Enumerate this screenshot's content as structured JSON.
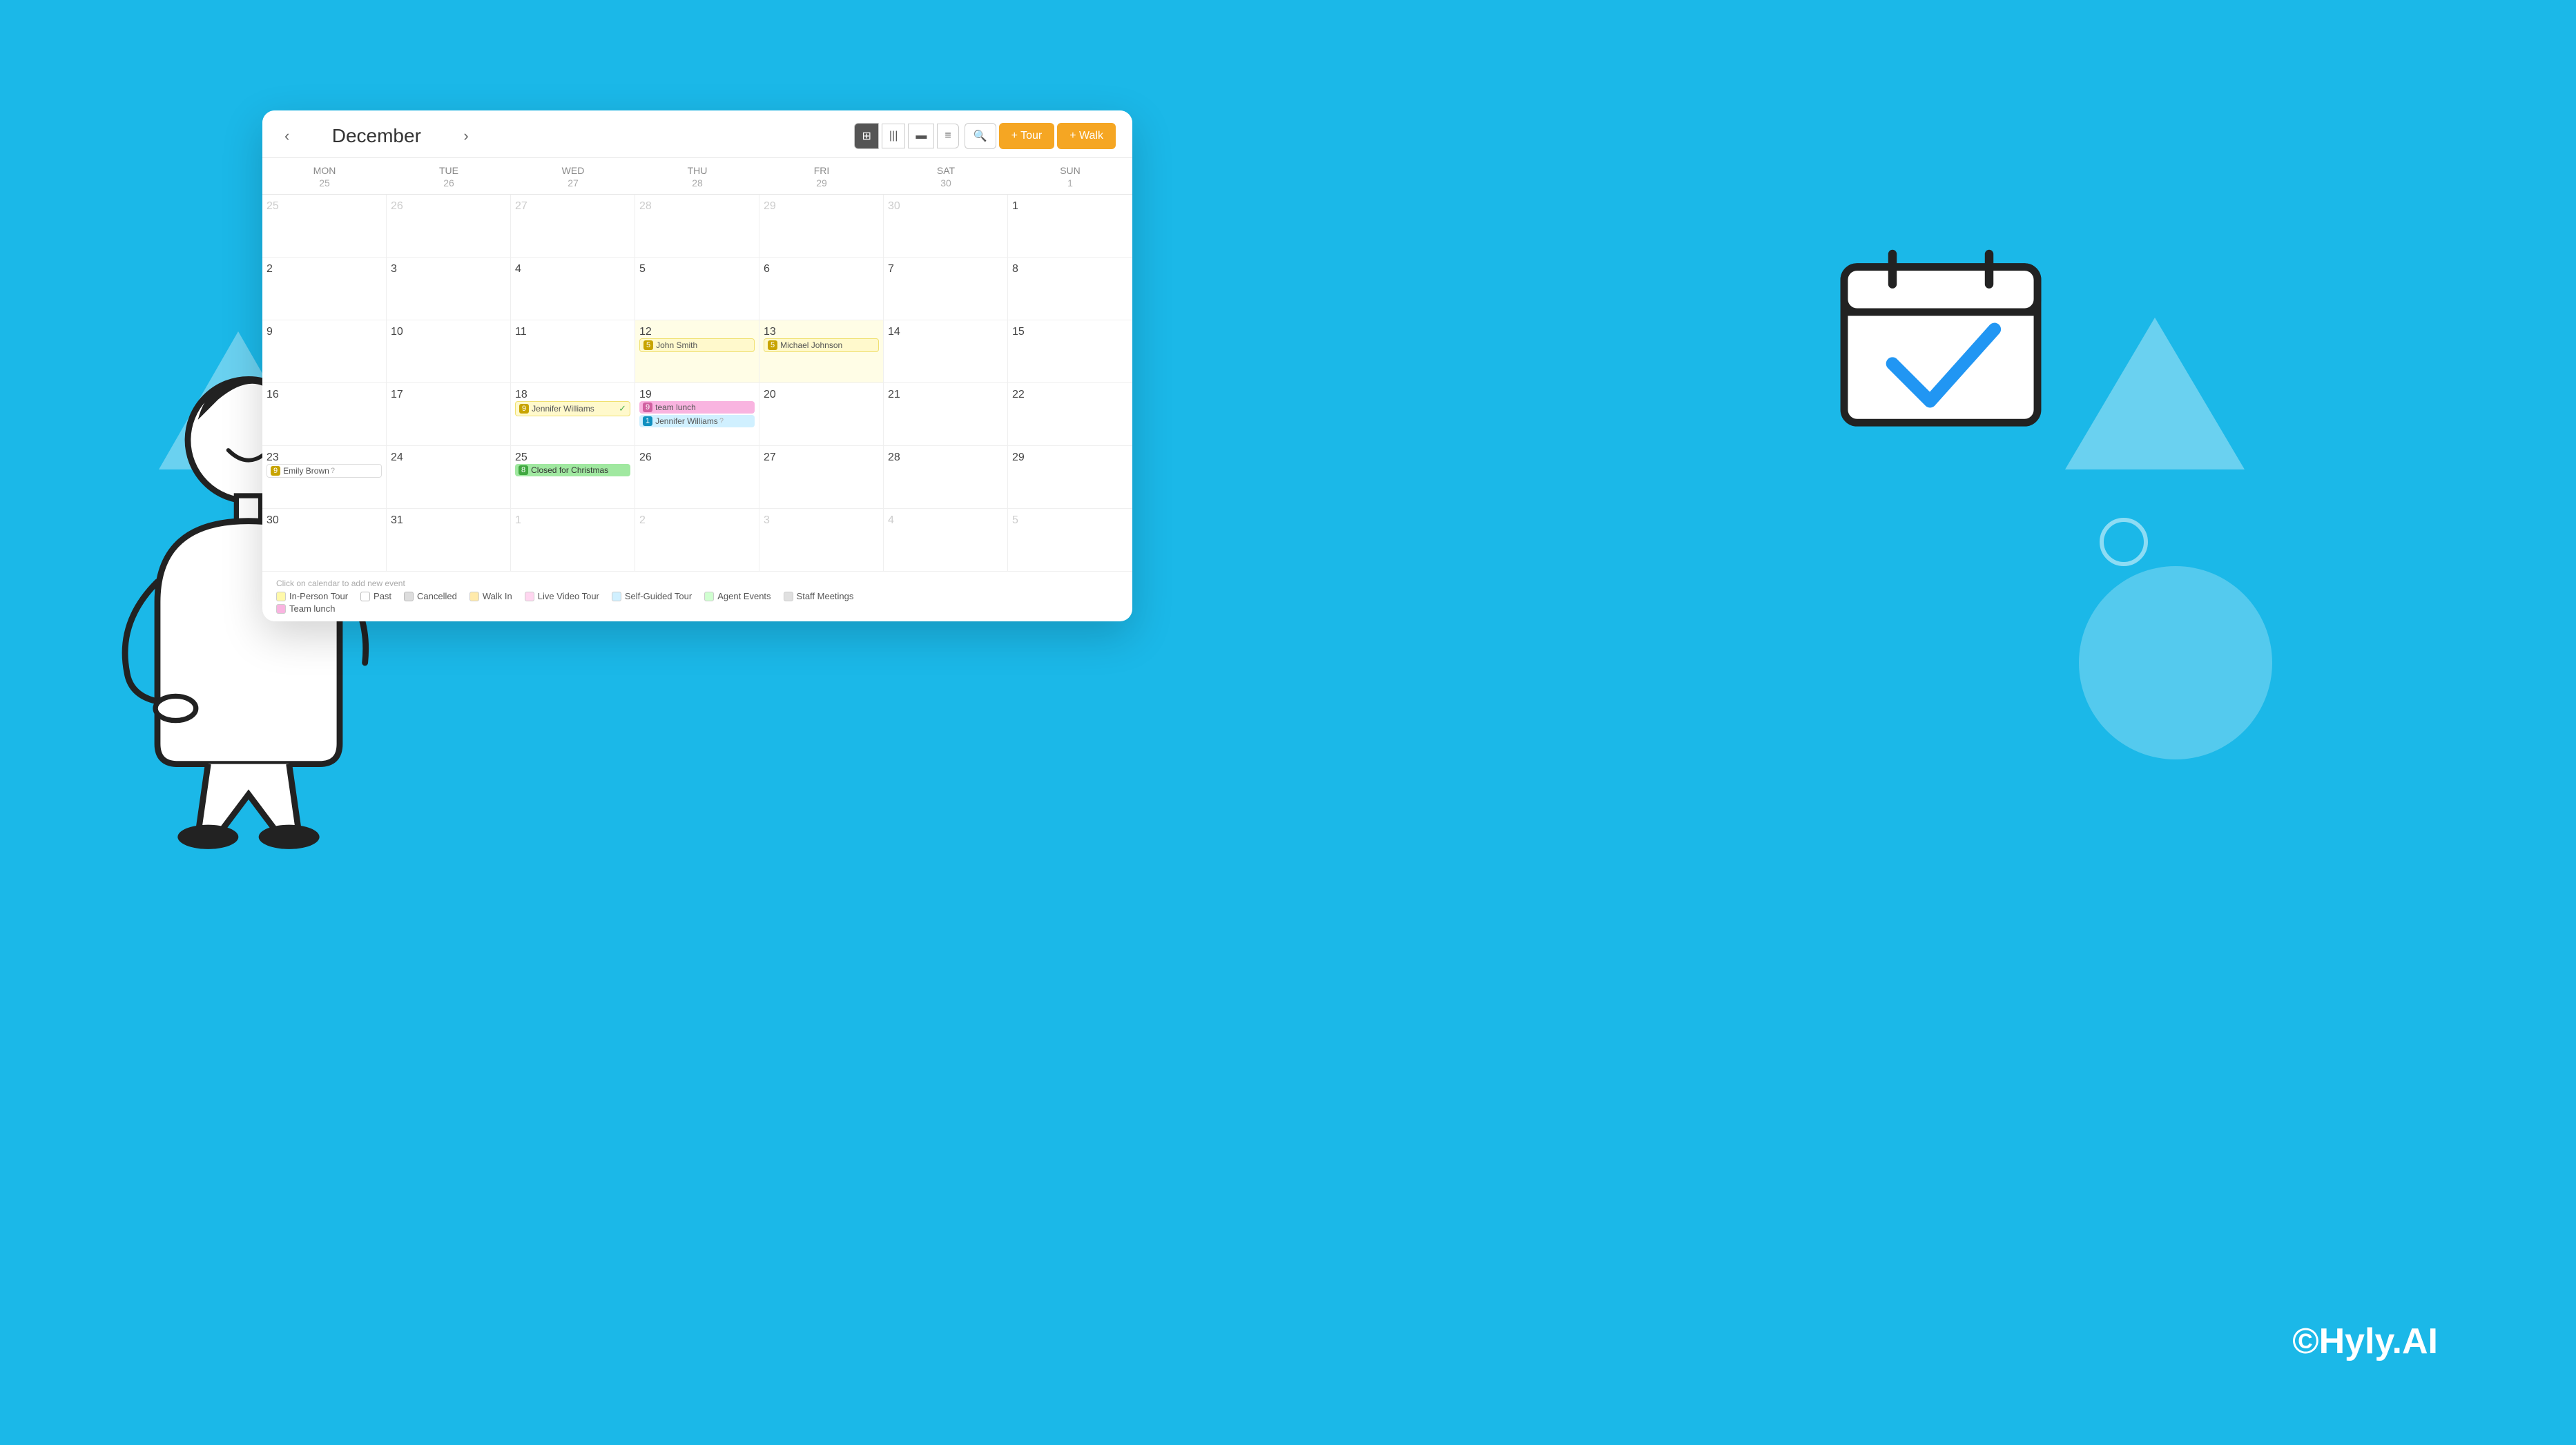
{
  "background": {
    "color": "#1bb8e8"
  },
  "credit": "©Hyly.AI",
  "header": {
    "prev_label": "‹",
    "next_label": "›",
    "month_title": "December",
    "view_buttons": [
      {
        "label": "⊞",
        "id": "month",
        "active": true
      },
      {
        "label": "|||",
        "id": "week"
      },
      {
        "label": "▬",
        "id": "day"
      },
      {
        "label": "≡",
        "id": "list"
      }
    ],
    "search_label": "🔍",
    "tour_btn": "+ Tour",
    "walkin_btn": "+ Walk"
  },
  "days_header": [
    {
      "day": "MON",
      "date": "25"
    },
    {
      "day": "TUE",
      "date": "26"
    },
    {
      "day": "WED",
      "date": "27"
    },
    {
      "day": "THU",
      "date": "28"
    },
    {
      "day": "FRI",
      "date": "29"
    },
    {
      "day": "SAT",
      "date": "30"
    },
    {
      "day": "SUN",
      "date": "1"
    }
  ],
  "weeks": [
    {
      "cells": [
        {
          "date": "25",
          "other": true,
          "events": []
        },
        {
          "date": "26",
          "other": true,
          "events": []
        },
        {
          "date": "27",
          "other": true,
          "events": []
        },
        {
          "date": "28",
          "other": true,
          "events": []
        },
        {
          "date": "29",
          "other": true,
          "events": []
        },
        {
          "date": "30",
          "other": true,
          "events": []
        },
        {
          "date": "1",
          "events": []
        }
      ]
    },
    {
      "cells": [
        {
          "date": "2",
          "events": []
        },
        {
          "date": "3",
          "events": []
        },
        {
          "date": "4",
          "events": []
        },
        {
          "date": "5",
          "events": []
        },
        {
          "date": "6",
          "events": []
        },
        {
          "date": "7",
          "events": []
        },
        {
          "date": "8",
          "events": []
        }
      ]
    },
    {
      "cells": [
        {
          "date": "9",
          "events": []
        },
        {
          "date": "10",
          "events": []
        },
        {
          "date": "11",
          "events": []
        },
        {
          "date": "12",
          "highlight": true,
          "events": [
            {
              "num": "5",
              "name": "John Smith",
              "type": "in-person"
            }
          ]
        },
        {
          "date": "13",
          "highlight": true,
          "events": [
            {
              "num": "5",
              "name": "Michael Johnson",
              "type": "in-person"
            }
          ]
        },
        {
          "date": "14",
          "events": []
        },
        {
          "date": "15",
          "events": []
        }
      ]
    },
    {
      "cells": [
        {
          "date": "16",
          "events": []
        },
        {
          "date": "17",
          "events": []
        },
        {
          "date": "18",
          "events": [
            {
              "num": "9",
              "name": "Jennifer Williams",
              "type": "in-person",
              "check": true
            }
          ]
        },
        {
          "date": "19",
          "events": [
            {
              "num": "9",
              "name": "team lunch",
              "type": "team-lunch"
            },
            {
              "num": "1",
              "name": "Jennifer Williams",
              "type": "self-guided",
              "more": "?"
            }
          ]
        },
        {
          "date": "20",
          "events": []
        },
        {
          "date": "21",
          "events": []
        },
        {
          "date": "22",
          "events": []
        }
      ]
    },
    {
      "cells": [
        {
          "date": "23",
          "events": [
            {
              "num": "9",
              "name": "Emily Brown",
              "type": "emily",
              "more": "?"
            }
          ]
        },
        {
          "date": "24",
          "events": []
        },
        {
          "date": "25",
          "events": [
            {
              "num": "8",
              "name": "Closed for Christmas",
              "type": "closed"
            }
          ]
        },
        {
          "date": "26",
          "events": []
        },
        {
          "date": "27",
          "events": []
        },
        {
          "date": "28",
          "events": []
        },
        {
          "date": "29",
          "events": []
        }
      ]
    },
    {
      "cells": [
        {
          "date": "30",
          "events": []
        },
        {
          "date": "31",
          "events": []
        },
        {
          "date": "1",
          "other": true,
          "events": []
        },
        {
          "date": "2",
          "other": true,
          "events": []
        },
        {
          "date": "3",
          "other": true,
          "events": []
        },
        {
          "date": "4",
          "other": true,
          "events": []
        },
        {
          "date": "5",
          "other": true,
          "events": []
        }
      ]
    }
  ],
  "footer": {
    "hint": "Click on calendar to add new event",
    "legend": [
      {
        "label": "In-Person Tour",
        "class": "in-person"
      },
      {
        "label": "Past",
        "class": "past"
      },
      {
        "label": "Cancelled",
        "class": "cancelled"
      },
      {
        "label": "Walk In",
        "class": "walk-in"
      },
      {
        "label": "Live Video Tour",
        "class": "live-video"
      },
      {
        "label": "Self-Guided Tour",
        "class": "self-guided"
      },
      {
        "label": "Agent Events",
        "class": "agent"
      },
      {
        "label": "Staff Meetings",
        "class": "staff"
      }
    ],
    "legend2": [
      {
        "label": "Team lunch",
        "class": "team-lunch"
      }
    ]
  }
}
